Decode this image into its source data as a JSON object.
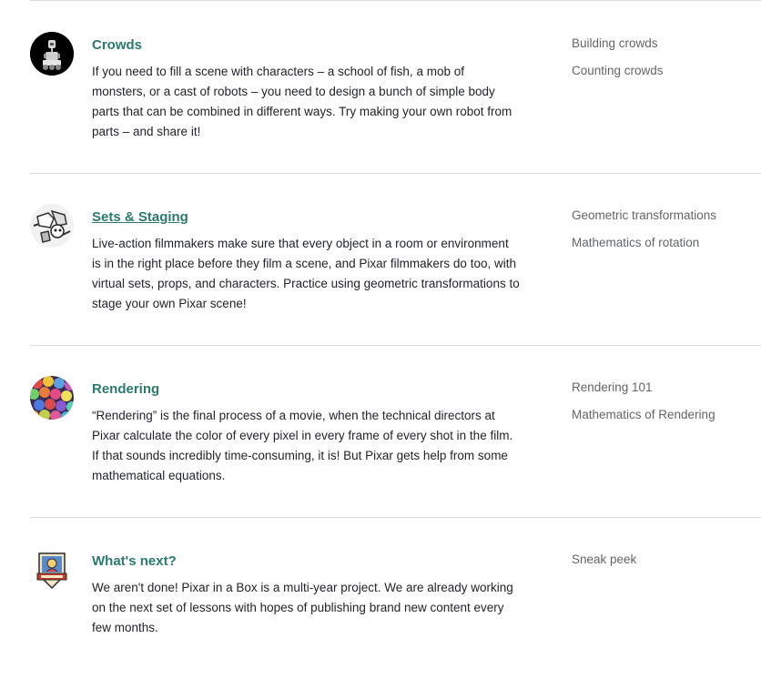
{
  "sections": [
    {
      "title": "Crowds",
      "description": "If you need to fill a scene with characters – a school of fish, a mob of monsters, or a cast of robots – you need to design a bunch of simple body parts that can be combined in different ways. Try making your own robot from parts – and share it!",
      "lessons": [
        "Building crowds",
        "Counting crowds"
      ],
      "icon": "robot-icon"
    },
    {
      "title": "Sets & Staging",
      "description": "Live-action filmmakers make sure that every object in a room or environment is in the right place before they film a scene, and Pixar filmmakers do too, with virtual sets, props, and characters. Practice using geometric transformations to stage your own Pixar scene!",
      "lessons": [
        "Geometric transformations",
        "Mathematics of rotation"
      ],
      "icon": "sketch-icon"
    },
    {
      "title": "Rendering",
      "description": "“Rendering” is the final process of a movie, when the technical directors at Pixar calculate the color of every pixel in every frame of every shot in the film. If that sounds incredibly time-consuming, it is! But Pixar gets help from some mathematical equations.",
      "lessons": [
        "Rendering 101",
        "Mathematics of Rendering"
      ],
      "icon": "balloons-icon"
    },
    {
      "title": "What's next?",
      "description": "We aren't done! Pixar in a Box is a multi-year project. We are already working on the next set of lessons with hopes of publishing brand new content every few months.",
      "lessons": [
        "Sneak peek"
      ],
      "icon": "badge-icon"
    }
  ],
  "colors": {
    "title": "#2a7a6f",
    "body_text": "#21242c",
    "lesson_link": "#626569",
    "divider": "#dcdcdc"
  }
}
